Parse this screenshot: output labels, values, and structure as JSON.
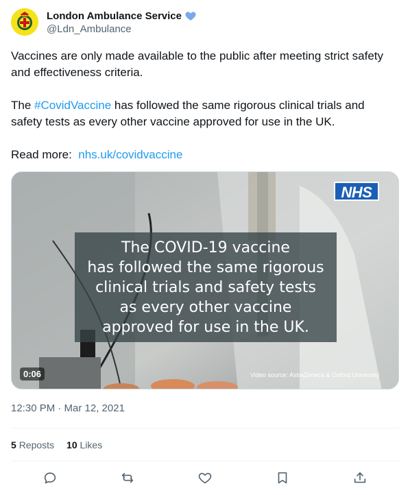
{
  "author": {
    "display_name": "London Ambulance Service",
    "handle": "@Ldn_Ambulance",
    "verified_heart_color": "#7aa8e8"
  },
  "tweet": {
    "line1": "Vaccines are only made available to the public after meeting strict safety",
    "line2": "and effectiveness criteria.",
    "p2_prefix": "The ",
    "hashtag": "#CovidVaccine",
    "p2_rest_line1": " has followed the same rigorous clinical trials and",
    "p2_line2": "safety tests as every other vaccine approved for use in the UK.",
    "read_more": "Read more:  ",
    "link": "nhs.uk/covidvaccine"
  },
  "media": {
    "logo": "NHS",
    "caption_lines": [
      "The COVID-19 vaccine",
      "has followed the same rigorous",
      "clinical trials and safety tests",
      "as every other vaccine",
      "approved for use in the UK."
    ],
    "duration": "0:06",
    "source": "Video source: AstraZeneca & Oxford University"
  },
  "meta": {
    "timestamp": "12:30 PM · Mar 12, 2021"
  },
  "stats": {
    "reposts_count": "5",
    "reposts_label": "Reposts",
    "likes_count": "10",
    "likes_label": "Likes"
  },
  "actions": [
    "reply-icon",
    "repost-icon",
    "like-icon",
    "bookmark-icon",
    "share-icon"
  ],
  "colors": {
    "link": "#1d9bf0",
    "secondary_text": "#536471",
    "nhs_blue": "#1a5fb4"
  }
}
